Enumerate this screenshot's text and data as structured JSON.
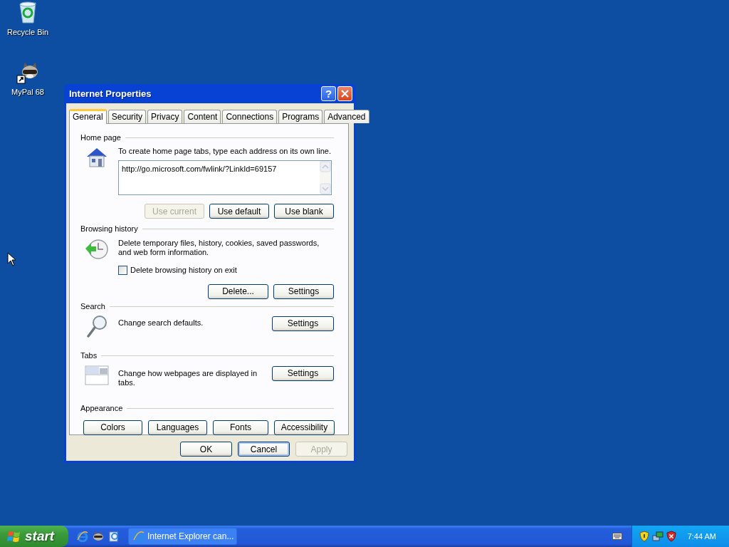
{
  "desktop_icons": [
    {
      "label": "Recycle Bin",
      "kind": "recycle"
    },
    {
      "label": "MyPal 68",
      "kind": "raccoon"
    }
  ],
  "dialog": {
    "title": "Internet Properties",
    "help": "?",
    "tabs": [
      {
        "label": "General",
        "selected": true
      },
      {
        "label": "Security",
        "selected": false
      },
      {
        "label": "Privacy",
        "selected": false
      },
      {
        "label": "Content",
        "selected": false
      },
      {
        "label": "Connections",
        "selected": false
      },
      {
        "label": "Programs",
        "selected": false
      },
      {
        "label": "Advanced",
        "selected": false
      }
    ],
    "sections": [
      {
        "kind": "home",
        "heading": "Home page",
        "description": "To create home page tabs, type each address on its own line.",
        "field": {
          "value": "http://go.microsoft.com/fwlink/?LinkId=69157"
        },
        "buttons": [
          {
            "label": "Use current",
            "disabled": true
          },
          {
            "label": "Use default",
            "disabled": false
          },
          {
            "label": "Use blank",
            "disabled": false
          }
        ]
      },
      {
        "kind": "history",
        "heading": "Browsing history",
        "description": "Delete temporary files, history, cookies, saved passwords, and web form information.",
        "checkbox": {
          "label": "Delete browsing history on exit",
          "checked": false
        },
        "buttons": [
          {
            "label": "Delete...",
            "disabled": false
          },
          {
            "label": "Settings",
            "disabled": false
          }
        ]
      },
      {
        "kind": "search",
        "heading": "Search",
        "description": "Change search defaults.",
        "buttons": [
          {
            "label": "Settings",
            "disabled": false
          }
        ]
      },
      {
        "kind": "tabs",
        "heading": "Tabs",
        "description": "Change how webpages are displayed in tabs.",
        "buttons": [
          {
            "label": "Settings",
            "disabled": false
          }
        ]
      },
      {
        "kind": "appearance",
        "heading": "Appearance",
        "buttons": [
          {
            "label": "Colors",
            "disabled": false
          },
          {
            "label": "Languages",
            "disabled": false
          },
          {
            "label": "Fonts",
            "disabled": false
          },
          {
            "label": "Accessibility",
            "disabled": false
          }
        ]
      }
    ],
    "footer_buttons": [
      {
        "label": "OK",
        "disabled": false,
        "focused": false
      },
      {
        "label": "Cancel",
        "disabled": false,
        "focused": true
      },
      {
        "label": "Apply",
        "disabled": true,
        "focused": false
      }
    ]
  },
  "taskbar": {
    "start_label": "start",
    "tasks": [
      {
        "label": "Internet Explorer can..."
      }
    ],
    "clock": "7:44 AM"
  }
}
